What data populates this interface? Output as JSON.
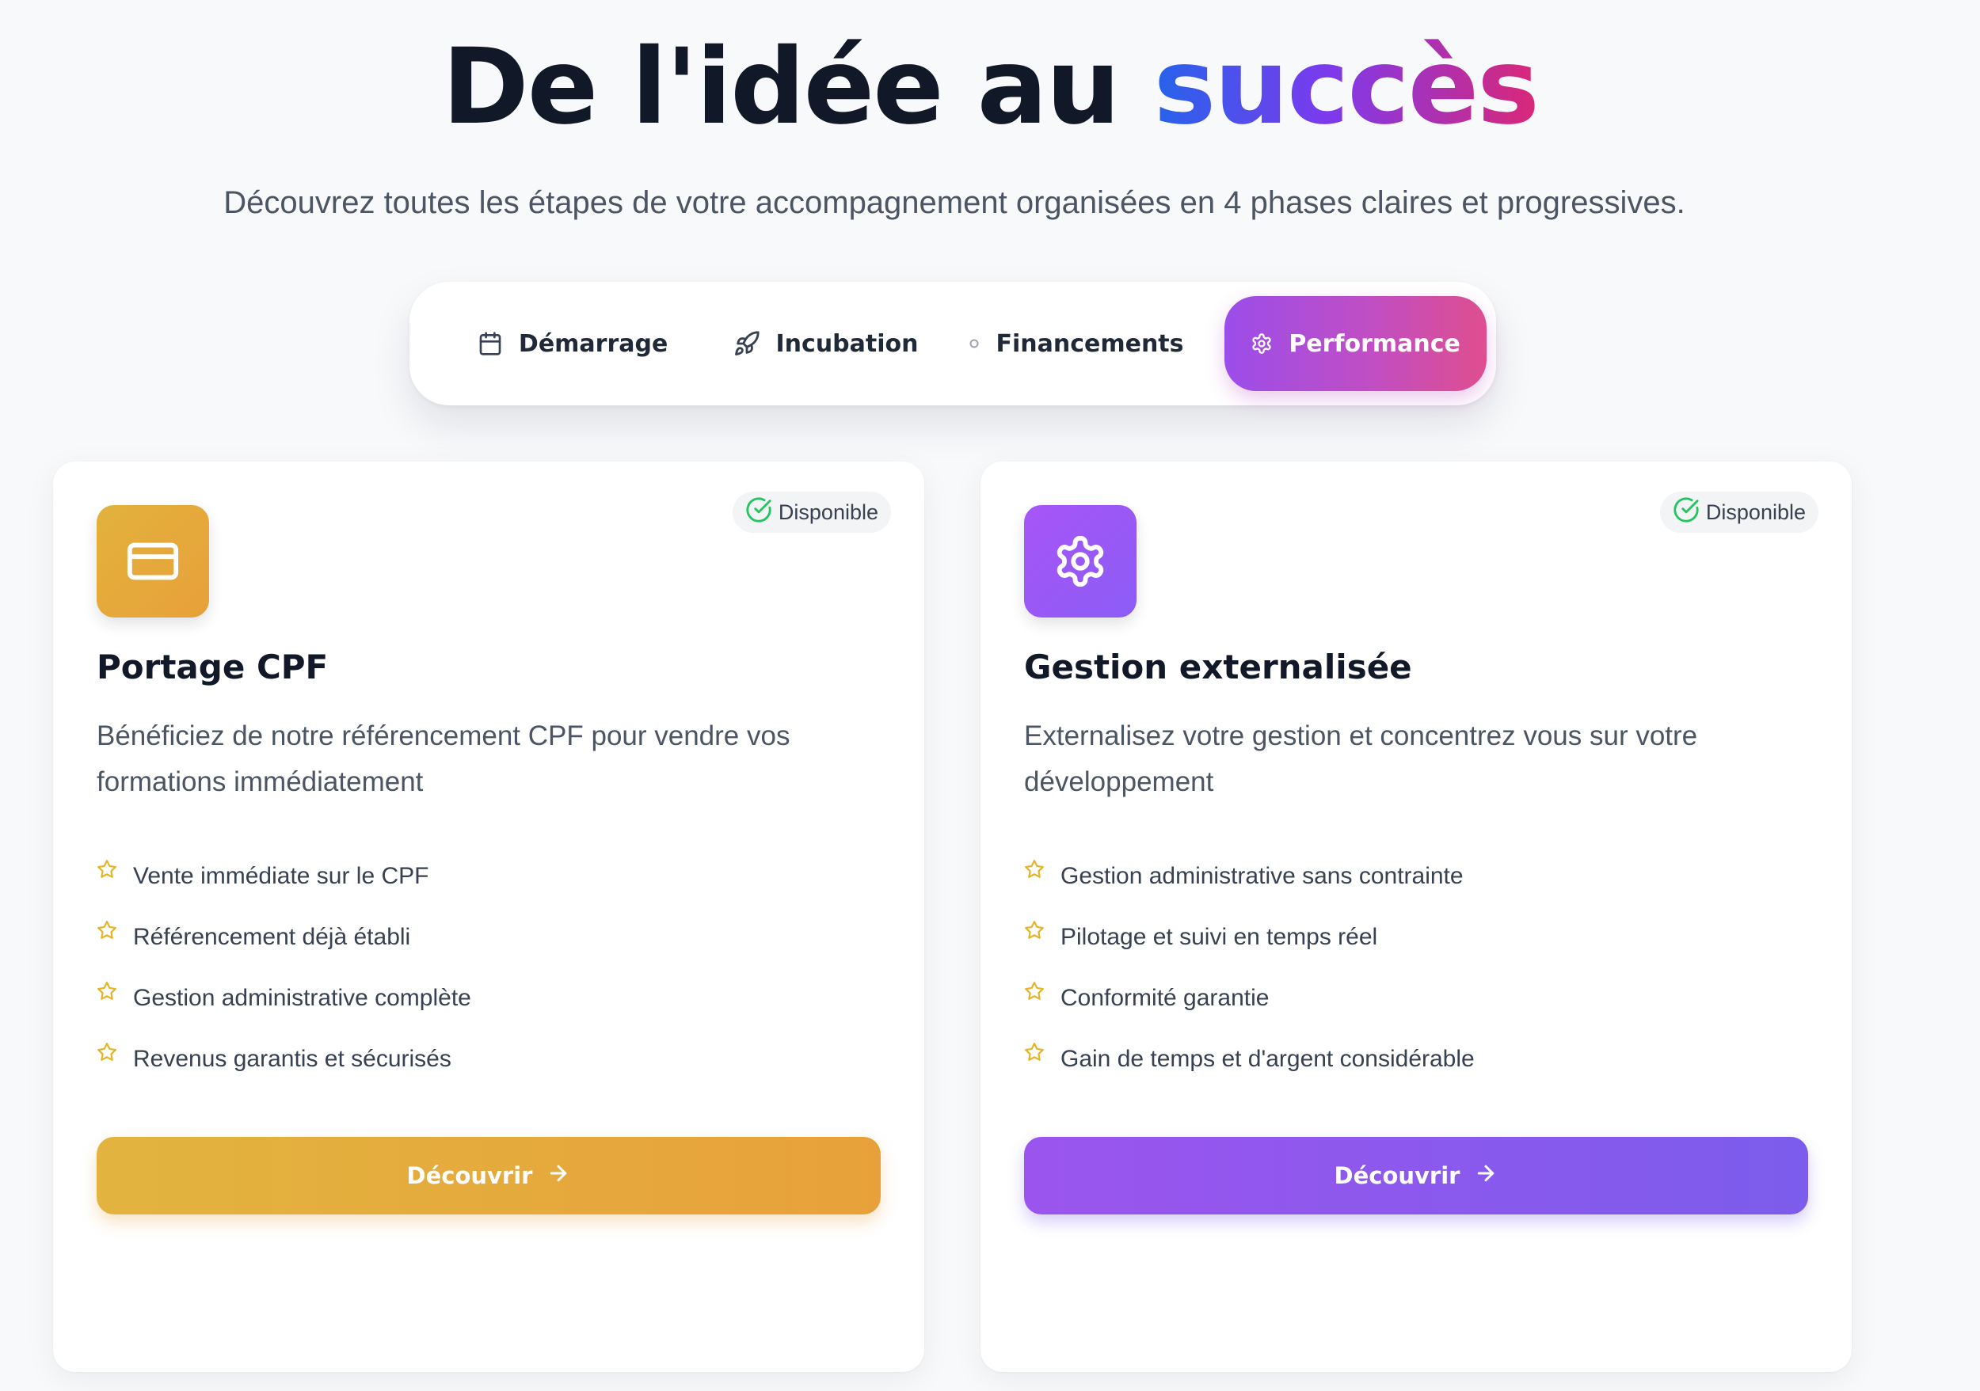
{
  "hero": {
    "title_main": "De l'idée au ",
    "title_accent": "succès",
    "subtitle": "Découvrez toutes les étapes de votre accompagnement organisées en 4 phases claires et progressives."
  },
  "tabs": [
    {
      "label": "Démarrage",
      "icon": "calendar-icon",
      "active": false
    },
    {
      "label": "Incubation",
      "icon": "rocket-icon",
      "active": false
    },
    {
      "label": "Financements",
      "icon": "dot-icon",
      "active": false
    },
    {
      "label": "Performance",
      "icon": "gear-icon",
      "active": true
    }
  ],
  "cards": [
    {
      "icon": "credit-card-icon",
      "accent_color": "#e6a93b",
      "badge": "Disponible",
      "title": "Portage CPF",
      "description": "Bénéficiez de notre référencement CPF pour vendre vos formations immédiatement",
      "features": [
        "Vente immédiate sur le CPF",
        "Référencement déjà établi",
        "Gestion administrative complète",
        "Revenus garantis et sécurisés"
      ],
      "cta": "Découvrir"
    },
    {
      "icon": "gear-icon",
      "accent_color": "#8b5cf6",
      "badge": "Disponible",
      "title": "Gestion externalisée",
      "description": "Externalisez votre gestion et concentrez vous sur votre développement",
      "features": [
        "Gestion administrative sans contrainte",
        "Pilotage et suivi en temps réel",
        "Conformité garantie",
        "Gain de temps et d'argent considérable"
      ],
      "cta": "Découvrir"
    }
  ],
  "colors": {
    "star": "#e6b325",
    "badge_check": "#22c55e",
    "title_gradient": [
      "#2563eb",
      "#7c3aed",
      "#db2777"
    ],
    "active_tab_gradient": [
      "#9b4dea",
      "#df4e8e"
    ]
  }
}
